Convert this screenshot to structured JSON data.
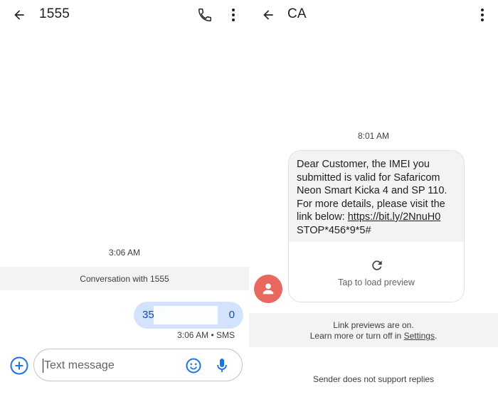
{
  "left": {
    "title": "1555",
    "timestamp": "3:06 AM",
    "conversation_banner": "Conversation with 1555",
    "outgoing": {
      "text_start": "35",
      "text_end": "0",
      "meta": "3:06 AM • SMS"
    },
    "composer": {
      "placeholder": "Text message"
    }
  },
  "right": {
    "title": "CA",
    "timestamp": "8:01 AM",
    "message": {
      "body": "Dear Customer, the IMEI you submitted is valid for Safaricom Neon Smart Kicka 4 and SP 110. For more details, please visit the link below: ",
      "link": "https://bit.ly/2NnuH0",
      "tail": "STOP*456*9*5#"
    },
    "preview_label": "Tap to load preview",
    "link_previews_line1": "Link previews are on.",
    "link_previews_line2_prefix": "Learn more or turn off in ",
    "link_previews_settings": "Settings",
    "link_previews_suffix": ".",
    "no_reply": "Sender does not support replies"
  },
  "icons": {
    "back": "arrow-left-icon",
    "call": "phone-icon",
    "more": "more-vert-icon",
    "add": "add-circle-icon",
    "emoji": "emoji-icon",
    "mic": "mic-icon",
    "avatar": "person-icon",
    "refresh": "refresh-icon"
  },
  "colors": {
    "accent": "#1a73e8",
    "outgoing_bubble": "#d3e3fd",
    "incoming_bubble": "#f1f3f4",
    "avatar": "#e8675f"
  }
}
